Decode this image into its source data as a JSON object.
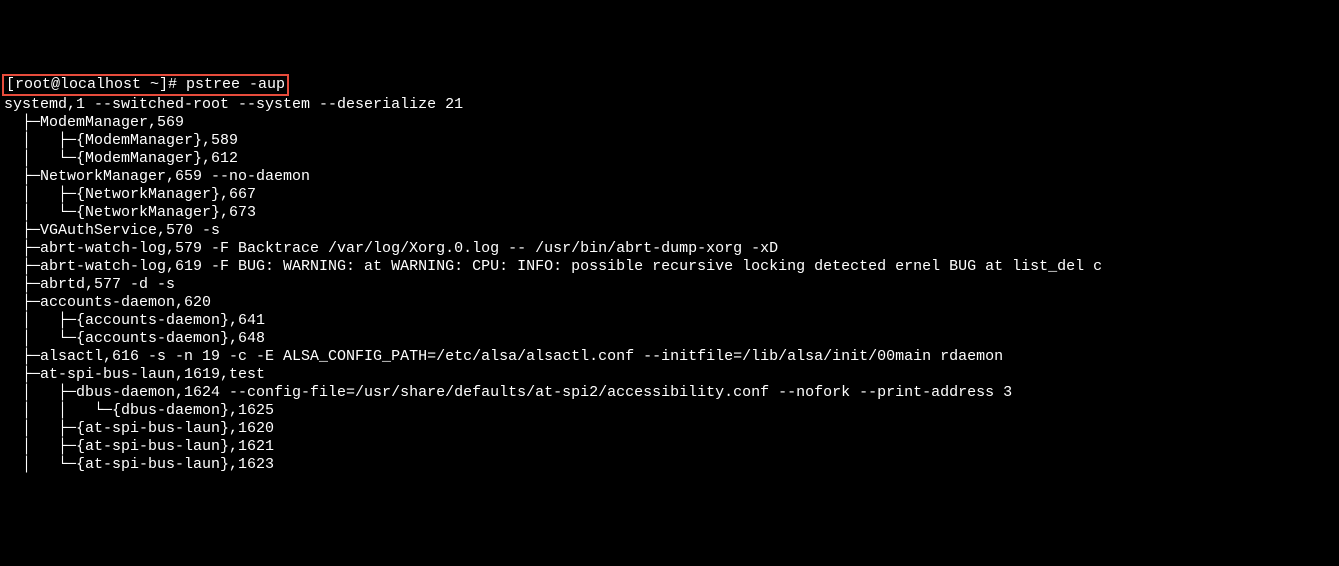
{
  "prompt": "[root@localhost ~]# ",
  "command": "pstree -aup",
  "lines": [
    "systemd,1 --switched-root --system --deserialize 21",
    "  ├─ModemManager,569",
    "  │   ├─{ModemManager},589",
    "  │   └─{ModemManager},612",
    "  ├─NetworkManager,659 --no-daemon",
    "  │   ├─{NetworkManager},667",
    "  │   └─{NetworkManager},673",
    "  ├─VGAuthService,570 -s",
    "  ├─abrt-watch-log,579 -F Backtrace /var/log/Xorg.0.log -- /usr/bin/abrt-dump-xorg -xD",
    "  ├─abrt-watch-log,619 -F BUG: WARNING: at WARNING: CPU: INFO: possible recursive locking detected ernel BUG at list_del c",
    "  ├─abrtd,577 -d -s",
    "  ├─accounts-daemon,620",
    "  │   ├─{accounts-daemon},641",
    "  │   └─{accounts-daemon},648",
    "  ├─alsactl,616 -s -n 19 -c -E ALSA_CONFIG_PATH=/etc/alsa/alsactl.conf --initfile=/lib/alsa/init/00main rdaemon",
    "  ├─at-spi-bus-laun,1619,test",
    "  │   ├─dbus-daemon,1624 --config-file=/usr/share/defaults/at-spi2/accessibility.conf --nofork --print-address 3",
    "  │   │   └─{dbus-daemon},1625",
    "  │   ├─{at-spi-bus-laun},1620",
    "  │   ├─{at-spi-bus-laun},1621",
    "  │   └─{at-spi-bus-laun},1623"
  ]
}
